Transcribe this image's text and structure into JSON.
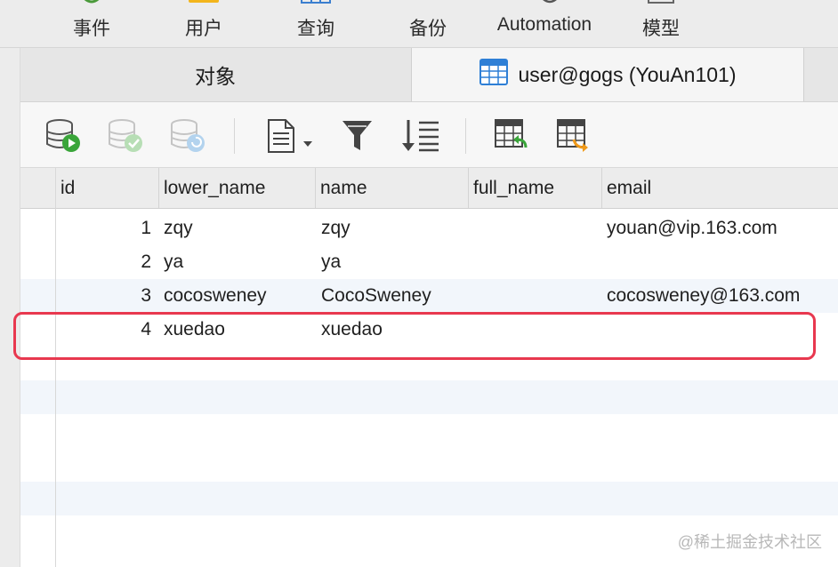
{
  "toolbar": {
    "items": [
      {
        "label": "事件",
        "icon": "event-icon"
      },
      {
        "label": "用户",
        "icon": "user-icon"
      },
      {
        "label": "查询",
        "icon": "query-icon"
      },
      {
        "label": "备份",
        "icon": "backup-icon"
      },
      {
        "label": "Automation",
        "icon": "automation-icon"
      },
      {
        "label": "模型",
        "icon": "model-icon"
      }
    ]
  },
  "tabs": {
    "objects_label": "对象",
    "table_label": "user@gogs (YouAn101)"
  },
  "object_toolbar": {
    "icons": [
      "begin-transaction-icon",
      "commit-icon",
      "rollback-icon",
      "text-view-icon",
      "filter-icon",
      "sort-icon",
      "import-icon",
      "export-icon"
    ]
  },
  "grid": {
    "columns": [
      "id",
      "lower_name",
      "name",
      "full_name",
      "email"
    ],
    "rows": [
      {
        "id": "1",
        "lower_name": "zqy",
        "name": "zqy",
        "full_name": "",
        "email": "youan@vip.163.com"
      },
      {
        "id": "2",
        "lower_name": "ya",
        "name": "ya",
        "full_name": "",
        "email": ""
      },
      {
        "id": "3",
        "lower_name": "cocosweney",
        "name": "CocoSweney",
        "full_name": "",
        "email": "cocosweney@163.com"
      },
      {
        "id": "4",
        "lower_name": "xuedao",
        "name": "xuedao",
        "full_name": "",
        "email": ""
      }
    ]
  },
  "colors": {
    "highlight": "#e8384f",
    "row_stripe": "#f2f6fb",
    "accent_blue": "#2e7fd6"
  },
  "watermark": "@稀土掘金技术社区"
}
